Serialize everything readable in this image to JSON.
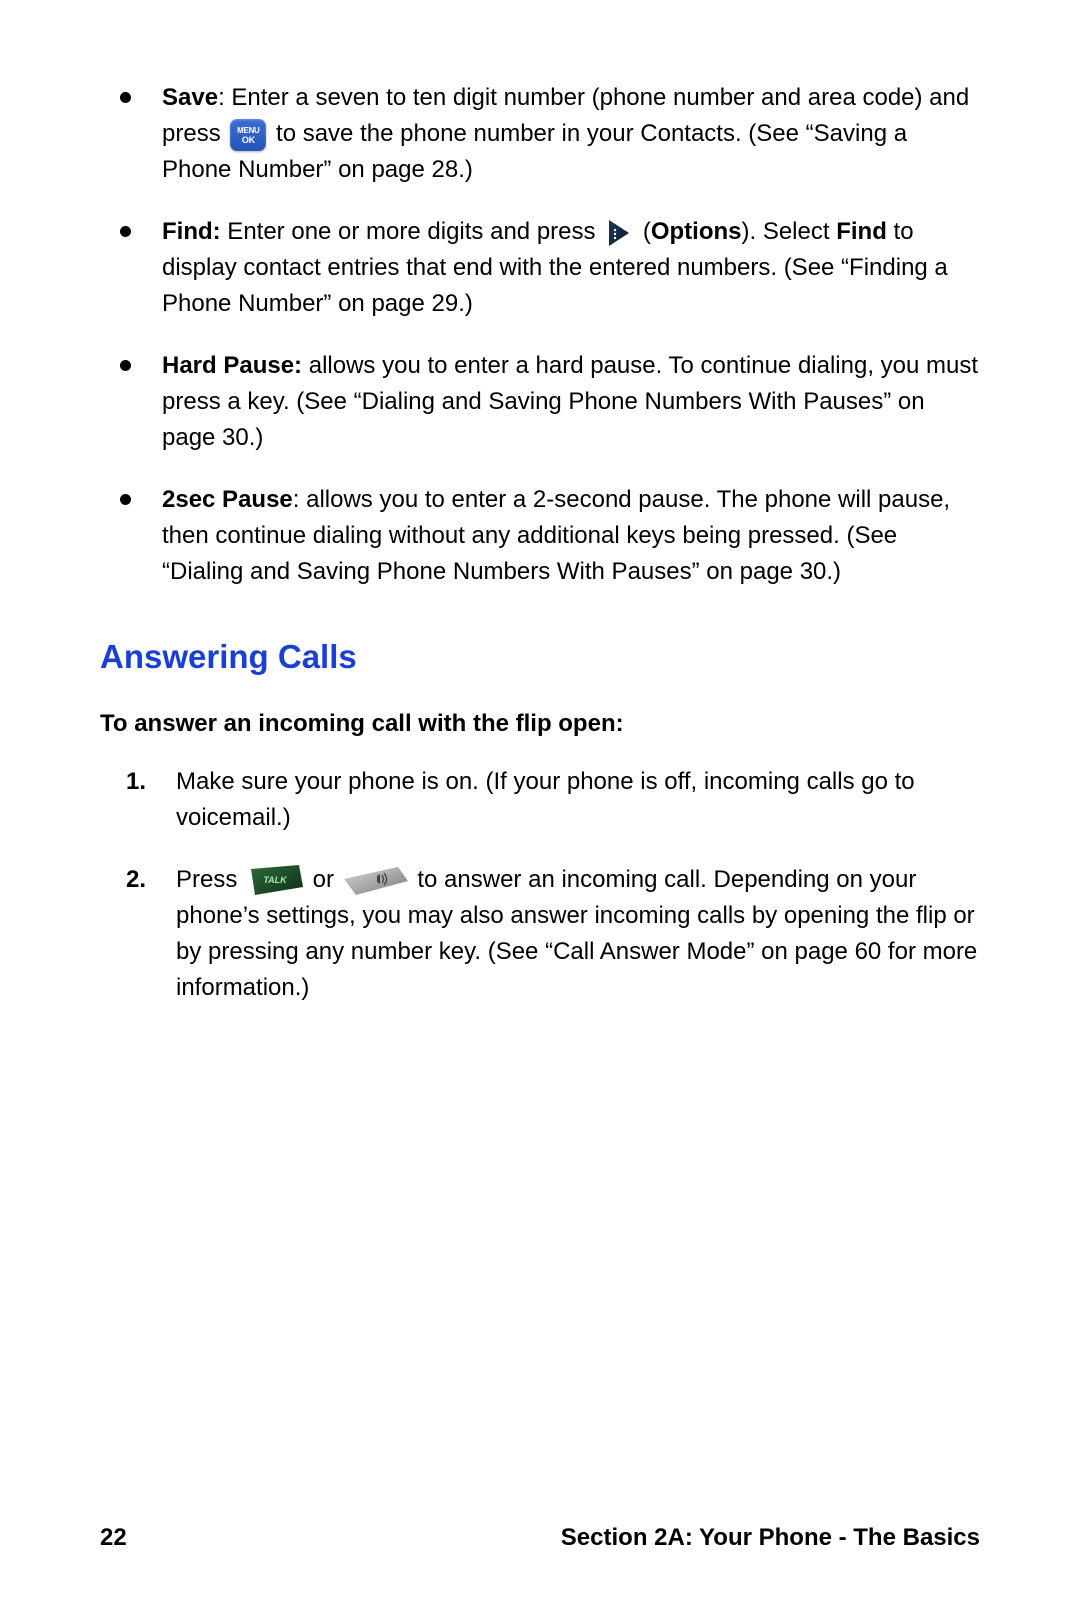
{
  "bullets": [
    {
      "label": "Save",
      "text_before": ": Enter a seven to ten digit number (phone number and area code) and press ",
      "text_after": " to save the phone number in your Contacts. (See “Saving a Phone Number” on page 28.)"
    },
    {
      "label": "Find:",
      "text_before": " Enter one or more digits and press ",
      "options_label": "Options",
      "text_paren_open": " (",
      "text_paren_close": "). Select ",
      "find_label": "Find",
      "text_after": " to display contact entries that end with the entered numbers. (See “Finding a Phone Number” on page 29.)"
    },
    {
      "label": "Hard Pause:",
      "text": " allows you to enter a hard pause. To continue dialing, you must press a key. (See “Dialing and Saving Phone Numbers With Pauses” on page 30.)"
    },
    {
      "label": "2sec Pause",
      "text": ": allows you to enter a 2-second pause. The phone will pause, then continue dialing without any additional keys being pressed. (See “Dialing and Saving Phone Numbers With Pauses” on page 30.)"
    }
  ],
  "heading": "Answering Calls",
  "sub_heading": "To answer an incoming call with the flip open:",
  "steps": [
    {
      "num": "1.",
      "text": "Make sure your phone is on. (If your phone is off, incoming calls go to voicemail.)"
    },
    {
      "num": "2.",
      "text_before": "Press ",
      "text_or": " or ",
      "text_after": " to answer an incoming call. Depending on your phone’s settings, you may also answer incoming calls by opening the flip or by pressing any number key. (See “Call Answer Mode” on page 60 for more information.)"
    }
  ],
  "footer": {
    "page_number": "22",
    "section_text": "Section 2A: Your Phone - The Basics"
  },
  "icons": {
    "menu_ok_top": "MENU",
    "menu_ok_bottom": "OK",
    "talk_label": "TALK"
  }
}
